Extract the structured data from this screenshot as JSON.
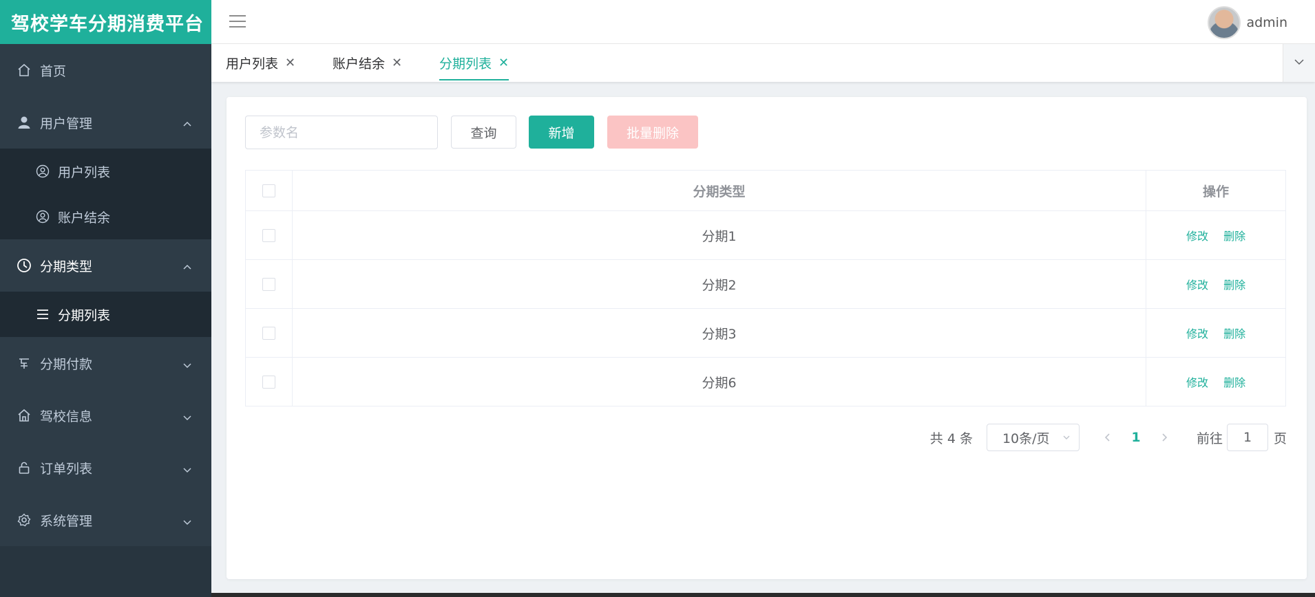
{
  "app": {
    "title": "驾校学车分期消费平台"
  },
  "sidebar": {
    "items": [
      {
        "label": "首页",
        "icon": "home-icon"
      },
      {
        "label": "用户管理",
        "icon": "user-icon",
        "children": [
          "用户列表",
          "账户结余"
        ]
      },
      {
        "label": "分期类型",
        "icon": "clock-icon",
        "children": [
          "分期列表"
        ]
      },
      {
        "label": "分期付款",
        "icon": "payment-icon"
      },
      {
        "label": "驾校信息",
        "icon": "school-icon"
      },
      {
        "label": "订单列表",
        "icon": "lock-icon"
      },
      {
        "label": "系统管理",
        "icon": "gear-icon"
      }
    ]
  },
  "header": {
    "username": "admin"
  },
  "tabs": [
    {
      "label": "用户列表",
      "active": false
    },
    {
      "label": "账户结余",
      "active": false
    },
    {
      "label": "分期列表",
      "active": true
    }
  ],
  "search": {
    "placeholder": "参数名",
    "query_label": "查询",
    "add_label": "新增",
    "batch_delete_label": "批量删除"
  },
  "table": {
    "headers": {
      "type": "分期类型",
      "op": "操作"
    },
    "rows": [
      {
        "type": "分期1",
        "edit": "修改",
        "delete": "删除"
      },
      {
        "type": "分期2",
        "edit": "修改",
        "delete": "删除"
      },
      {
        "type": "分期3",
        "edit": "修改",
        "delete": "删除"
      },
      {
        "type": "分期6",
        "edit": "修改",
        "delete": "删除"
      }
    ]
  },
  "pagination": {
    "total_text": "共 4 条",
    "page_size": "10条/页",
    "current_page": "1",
    "goto_prefix": "前往",
    "goto_value": "1",
    "goto_suffix": "页"
  },
  "colors": {
    "accent": "#1fb09b",
    "sidebar_bg": "#2e3c47",
    "danger_light": "#fbc4c4"
  }
}
